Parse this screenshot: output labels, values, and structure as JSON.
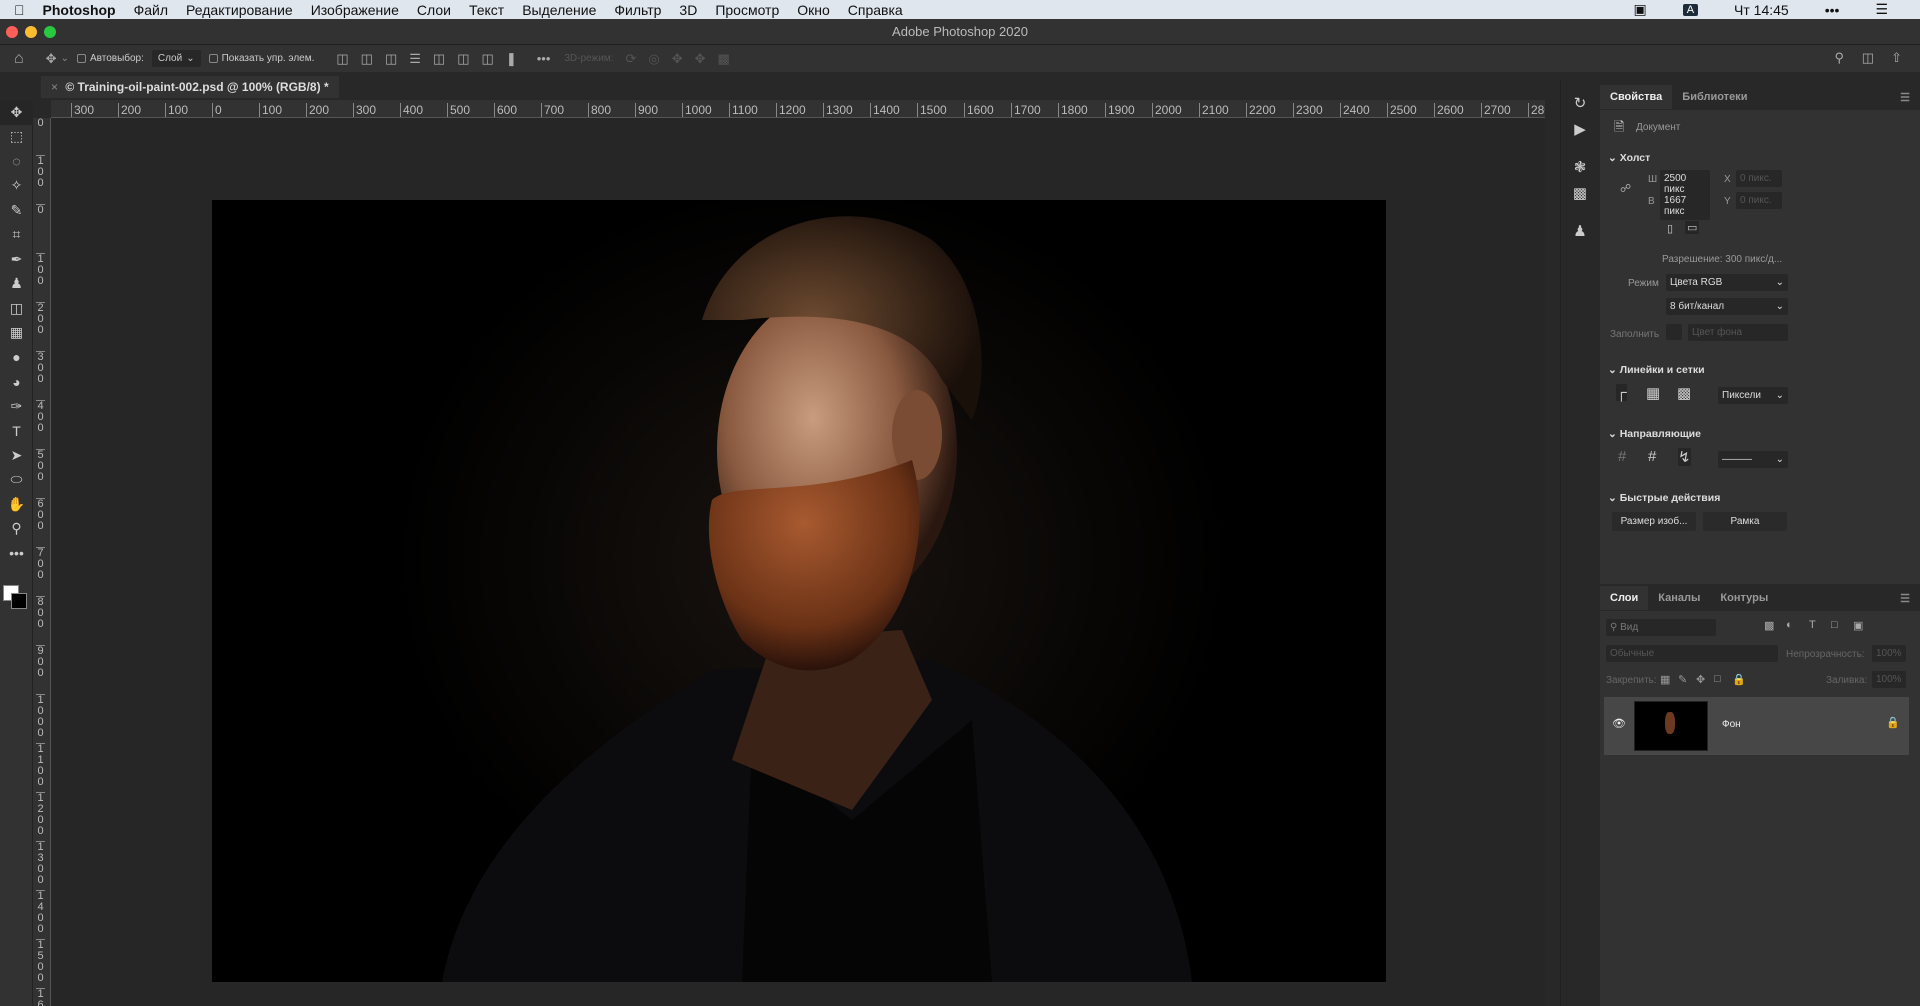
{
  "menubar": {
    "apple_icon": "apple-icon",
    "items": [
      "Photoshop",
      "Файл",
      "Редактирование",
      "Изображение",
      "Слои",
      "Текст",
      "Выделение",
      "Фильтр",
      "3D",
      "Просмотр",
      "Окно",
      "Справка"
    ],
    "input_lang": "A",
    "clock": "Чт 14:45"
  },
  "window": {
    "title": "Adobe Photoshop 2020",
    "close_color": "#fe5f57",
    "min_color": "#febc2e",
    "max_color": "#28c840"
  },
  "options": {
    "autoselect_label": "Автовыбор:",
    "autoselect_value": "Слой",
    "show_transform_label": "Показать упр. элем.",
    "mode3d_label": "3D-режим:",
    "more": "•••"
  },
  "document_tab": {
    "title": "© Training-oil-paint-002.psd @ 100% (RGB/8) *",
    "close": "×"
  },
  "ruler": {
    "h_labels": [
      "300",
      "200",
      "100",
      "0",
      "100",
      "200",
      "300",
      "400",
      "500",
      "600",
      "700",
      "800",
      "900",
      "1000",
      "1100",
      "1200",
      "1300",
      "1400",
      "1500",
      "1600",
      "1700",
      "1800",
      "1900",
      "2000",
      "2100",
      "2200",
      "2300",
      "2400",
      "2500",
      "2600",
      "2700",
      "280"
    ],
    "v_labels": [
      "00",
      "100",
      "0",
      "100",
      "200",
      "300",
      "400",
      "500",
      "600",
      "700",
      "800",
      "900",
      "1000",
      "1100",
      "1200",
      "1300",
      "1400",
      "1500",
      "1600"
    ]
  },
  "tools": [
    "move",
    "marquee",
    "lasso",
    "magic-wand",
    "brush",
    "crop",
    "eyedropper",
    "stamp",
    "eraser",
    "gradient",
    "blur",
    "dodge",
    "pen",
    "type",
    "path-select",
    "ellipse",
    "hand",
    "zoom",
    "more"
  ],
  "properties": {
    "tabs": [
      "Свойства",
      "Библиотеки"
    ],
    "doc_label": "Документ",
    "canvas": {
      "title": "Холст",
      "w_label": "Ш",
      "w_value": "2500 пикс",
      "h_label": "В",
      "h_value": "1667 пикс",
      "x_label": "X",
      "x_value": "0 пикс.",
      "y_label": "Y",
      "y_value": "0 пикс.",
      "resolution": "Разрешение: 300 пикс/д...",
      "mode_label": "Режим",
      "mode_value": "Цвета RGB",
      "depth_value": "8 бит/канал",
      "fill_label": "Заполнить",
      "fill_value": "Цвет фона"
    },
    "rulers": {
      "title": "Линейки и сетки",
      "units": "Пиксели"
    },
    "guides": {
      "title": "Направляющие"
    },
    "quick": {
      "title": "Быстрые действия",
      "btn1": "Размер изоб...",
      "btn2": "Рамка"
    }
  },
  "layers": {
    "tabs": [
      "Слои",
      "Каналы",
      "Контуры"
    ],
    "search_placeholder": "Вид",
    "blend": "Обычные",
    "opacity_label": "Непрозрачность:",
    "opacity_value": "100%",
    "lock_label": "Закрепить:",
    "fill_label": "Заливка:",
    "fill_value": "100%",
    "items": [
      {
        "name": "Фон",
        "visible": true,
        "locked": true
      }
    ]
  }
}
